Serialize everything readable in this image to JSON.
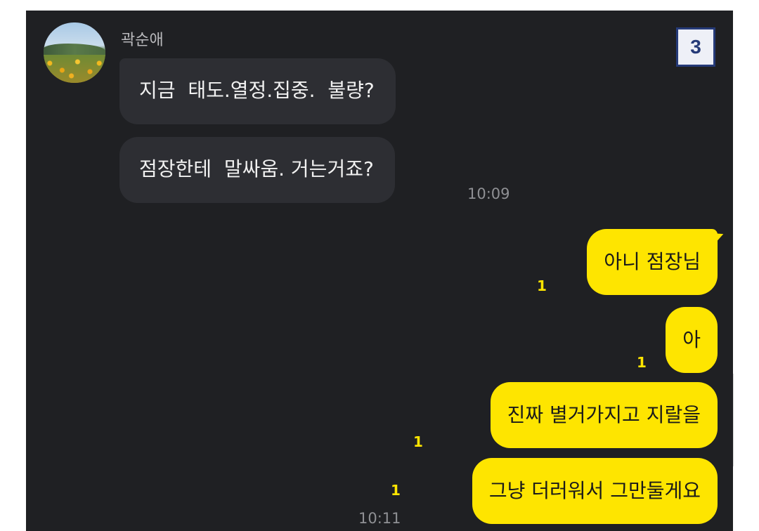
{
  "page_badge": "3",
  "incoming": {
    "sender_name": "곽순애",
    "messages": [
      "지금  태도.열정.집중.  불량?",
      "점장한테  말싸움. 거는거죠?"
    ],
    "time": "10:09"
  },
  "outgoing": {
    "messages": [
      {
        "text": "아니 점장님",
        "unread": "1"
      },
      {
        "text": "아",
        "unread": "1"
      },
      {
        "text": "진짜 별거가지고 지랄을",
        "unread": "1"
      },
      {
        "text": "그냥 더러워서 그만둘게요",
        "unread": "1"
      }
    ],
    "time": "10:11"
  },
  "colors": {
    "background": "#1f2023",
    "incoming_bubble": "#2d2e33",
    "outgoing_bubble": "#fee500",
    "unread_count": "#fee500"
  }
}
